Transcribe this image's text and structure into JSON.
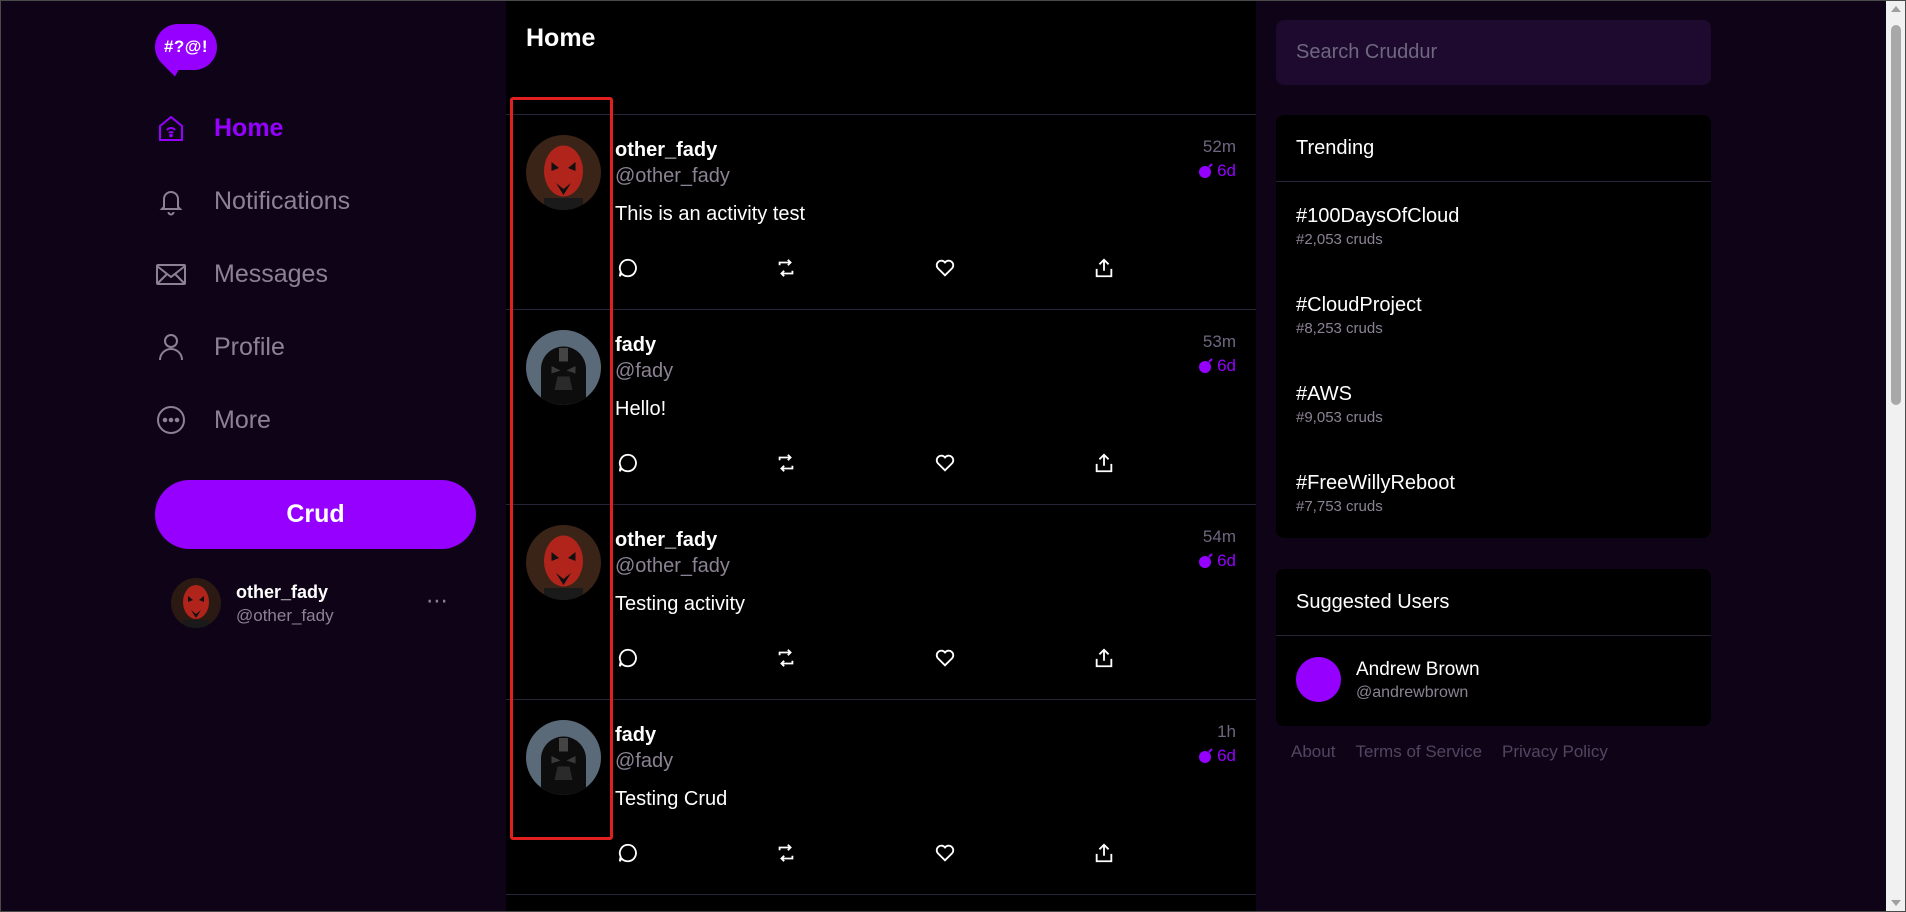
{
  "brand": {
    "logo_text": "#?@!",
    "accent": "#9500ff"
  },
  "nav": {
    "items": [
      {
        "label": "Home",
        "icon": "home-icon",
        "active": true
      },
      {
        "label": "Notifications",
        "icon": "bell-icon",
        "active": false
      },
      {
        "label": "Messages",
        "icon": "envelope-icon",
        "active": false
      },
      {
        "label": "Profile",
        "icon": "person-icon",
        "active": false
      },
      {
        "label": "More",
        "icon": "more-circle-icon",
        "active": false
      }
    ],
    "crud_button": "Crud"
  },
  "current_user": {
    "display_name": "other_fady",
    "handle": "@other_fady",
    "menu": "⋯"
  },
  "feed": {
    "title": "Home",
    "posts": [
      {
        "display_name": "other_fady",
        "handle": "@other_fady",
        "message": "This is an activity test",
        "time": "52m",
        "expires": "6d",
        "avatar": "maul"
      },
      {
        "display_name": "fady",
        "handle": "@fady",
        "message": "Hello!",
        "time": "53m",
        "expires": "6d",
        "avatar": "vader"
      },
      {
        "display_name": "other_fady",
        "handle": "@other_fady",
        "message": "Testing activity",
        "time": "54m",
        "expires": "6d",
        "avatar": "maul"
      },
      {
        "display_name": "fady",
        "handle": "@fady",
        "message": "Testing Crud",
        "time": "1h",
        "expires": "6d",
        "avatar": "vader"
      }
    ]
  },
  "search": {
    "placeholder": "Search Cruddur"
  },
  "trending": {
    "title": "Trending",
    "items": [
      {
        "tag": "#100DaysOfCloud",
        "count": "#2,053 cruds"
      },
      {
        "tag": "#CloudProject",
        "count": "#8,253 cruds"
      },
      {
        "tag": "#AWS",
        "count": "#9,053 cruds"
      },
      {
        "tag": "#FreeWillyReboot",
        "count": "#7,753 cruds"
      }
    ]
  },
  "suggested": {
    "title": "Suggested Users",
    "users": [
      {
        "name": "Andrew Brown",
        "handle": "@andrewbrown"
      }
    ]
  },
  "footer": {
    "links": [
      "About",
      "Terms of Service",
      "Privacy Policy"
    ]
  }
}
